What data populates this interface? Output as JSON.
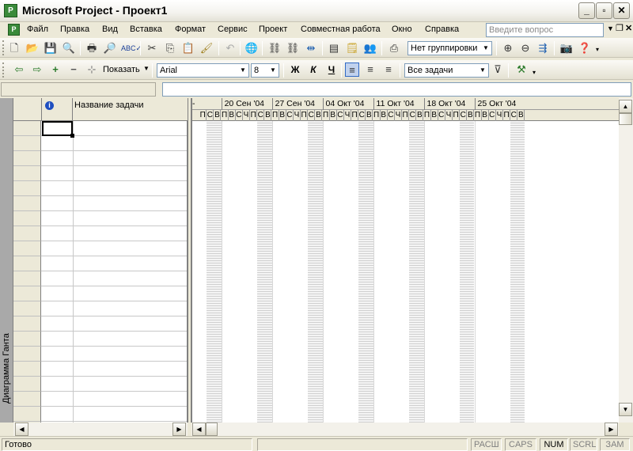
{
  "window": {
    "title": "Microsoft Project - Проект1",
    "app_icon": "project-icon",
    "buttons": [
      "minimize-icon",
      "restore-icon",
      "close-icon"
    ]
  },
  "menubar": {
    "items": [
      "Файл",
      "Правка",
      "Вид",
      "Вставка",
      "Формат",
      "Сервис",
      "Проект",
      "Совместная работа",
      "Окно",
      "Справка"
    ],
    "help_placeholder": "Введите вопрос"
  },
  "toolbar_standard": {
    "icons": [
      "new-icon",
      "open-icon",
      "save-icon",
      "search-icon",
      "print-icon",
      "print-preview-icon",
      "spelling-icon",
      "cut-icon",
      "copy-icon",
      "paste-icon",
      "format-painter-icon",
      "undo-icon",
      "hyperlink-icon",
      "link-icon",
      "unlink-icon",
      "split-icon",
      "task-info-icon",
      "notes-icon",
      "assign-resources-icon",
      "copy-picture-icon",
      "zoom-in-icon",
      "zoom-out-icon",
      "goto-task-icon",
      "camera-icon",
      "help-icon"
    ],
    "grouping": "Нет группировки"
  },
  "toolbar_format": {
    "show_label": "Показать",
    "font": "Arial",
    "font_size": "8",
    "bold": "Ж",
    "italic": "К",
    "underline": "Ч",
    "filter": "Все задачи"
  },
  "sheet": {
    "task_name_header": "Название задачи",
    "info_icon": "info-icon"
  },
  "viewbar": {
    "label": "Диаграмма Ганта"
  },
  "gantt": {
    "weeks": [
      "20 Сен '04",
      "27 Сен '04",
      "04 Окт '04",
      "11 Окт '04",
      "18 Окт '04",
      "25 Окт '04"
    ],
    "day_letters": [
      "П",
      "В",
      "С",
      "Ч",
      "П",
      "С",
      "В"
    ],
    "prev_days": [
      "П",
      "С",
      "В"
    ]
  },
  "status": {
    "ready": "Готово",
    "indicators": [
      "РАСШ",
      "CAPS",
      "NUM",
      "SCRL",
      "ЗАМ"
    ],
    "active": [
      "NUM"
    ]
  }
}
